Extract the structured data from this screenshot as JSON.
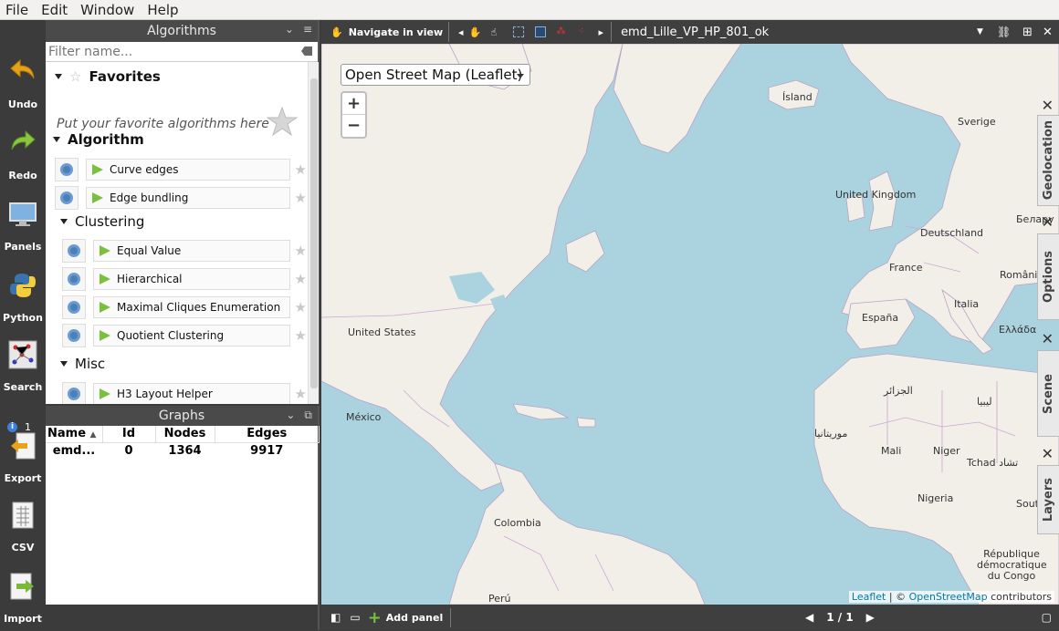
{
  "menu": [
    "File",
    "Edit",
    "Window",
    "Help"
  ],
  "toolbar": {
    "undo": "Undo",
    "redo": "Redo",
    "panels": "Panels",
    "python": "Python",
    "search": "Search",
    "info_count": "1",
    "export": "Export",
    "csv": "CSV",
    "import": "Import"
  },
  "algorithms": {
    "title": "Algorithms",
    "filter_placeholder": "Filter name...",
    "favorites_title": "Favorites",
    "favorites_hint": "Put your favorite algorithms here",
    "section_algorithm": "Algorithm",
    "items_top": [
      "Curve edges",
      "Edge bundling"
    ],
    "clustering_title": "Clustering",
    "clustering_items": [
      "Equal Value",
      "Hierarchical",
      "Maximal Cliques Enumeration",
      "Quotient Clustering"
    ],
    "misc_title": "Misc",
    "misc_items": [
      "H3 Layout Helper"
    ]
  },
  "graphs": {
    "title": "Graphs",
    "columns": [
      "Name",
      "Id",
      "Nodes",
      "Edges"
    ],
    "rows": [
      [
        "emd...",
        "0",
        "1364",
        "9917"
      ]
    ]
  },
  "view": {
    "nav_label": "Navigate in view",
    "graph_name": "emd_Lille_VP_HP_801_ok",
    "basemap": "Open Street Map (Leaflet)",
    "zoom_in": "+",
    "zoom_out": "−",
    "attribution_leaflet": "Leaflet",
    "attribution_sep": " | © ",
    "attribution_osm": "OpenStreetMap",
    "attribution_tail": " contributors",
    "labels": {
      "island": "Ísland",
      "sverige": "Sverige",
      "uk": "United Kingdom",
      "deutschland": "Deutschland",
      "belarus": "Белару",
      "france": "France",
      "romania": "România",
      "italia": "Italia",
      "espana": "España",
      "ellada": "Ελλάδα",
      "usa": "United States",
      "mexico": "México",
      "algeria": "الجزائر",
      "libya": "ليبيا",
      "mauritania": "موريتانيا",
      "mali": "Mali",
      "niger": "Niger",
      "chad": "Tchad تشاد",
      "south_sudan": "South Su",
      "nigeria": "Nigeria",
      "colombia": "Colombia",
      "drc": "République démocratique du Congo",
      "peru": "Perú"
    },
    "tabs": [
      "Geolocation",
      "Options",
      "Scene",
      "Layers"
    ]
  },
  "bottom": {
    "add_panel": "Add panel",
    "pager": "1 / 1"
  }
}
